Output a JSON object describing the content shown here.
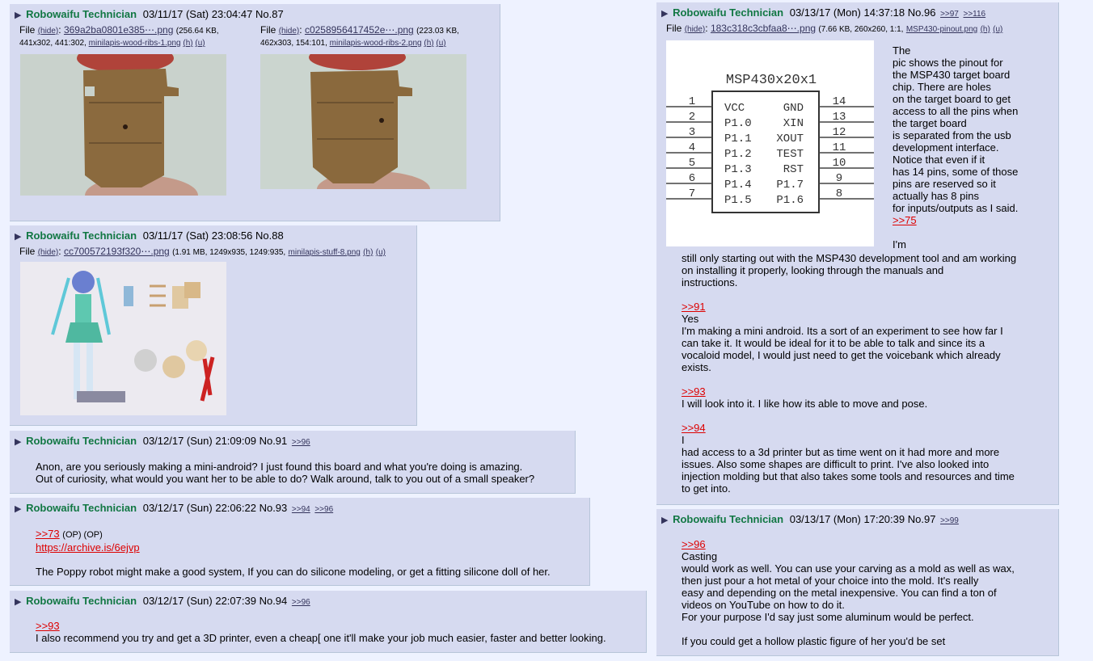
{
  "posts": {
    "p87": {
      "name": "Robowaifu Technician",
      "datetime": "03/11/17 (Sat) 23:04:47",
      "no": "No.87",
      "file1": {
        "label": "File",
        "hide": "(hide)",
        "fname": "369a2ba0801e385⋯.png",
        "meta1": "(256.64 KB,",
        "meta2": "441x302, 441:302,",
        "orig": "minilapis-wood-ribs-1.png",
        "h": "(h)",
        "u": "(u)"
      },
      "file2": {
        "label": "File",
        "hide": "(hide)",
        "fname": "c0258956417452e⋯.png",
        "meta1": "(223.03 KB,",
        "meta2": "462x303, 154:101,",
        "orig": "minilapis-wood-ribs-2.png",
        "h": "(h)",
        "u": "(u)"
      }
    },
    "p88": {
      "name": "Robowaifu Technician",
      "datetime": "03/11/17 (Sat) 23:08:56",
      "no": "No.88",
      "file": {
        "label": "File",
        "hide": "(hide)",
        "fname": "cc700572193f320⋯.png",
        "meta": "(1.91 MB, 1249x935, 1249:935,",
        "orig": "minilapis-stuff-8.png",
        "h": "(h)",
        "u": "(u)"
      }
    },
    "p91": {
      "name": "Robowaifu Technician",
      "datetime": "03/12/17 (Sun) 21:09:09",
      "no": "No.91",
      "backlinks": [
        ">>96"
      ],
      "text": "Anon, are you seriously making a mini-android? I just found this board and what you're doing is amazing.\nOut of curiosity, what would you want her to be able to do? Walk around, talk to you out of a small speaker?"
    },
    "p93": {
      "name": "Robowaifu Technician",
      "datetime": "03/12/17 (Sun) 22:06:22",
      "no": "No.93",
      "backlinks": [
        ">>94",
        ">>96"
      ],
      "quote": ">>73",
      "op": "(OP) (OP)",
      "link": "https://archive.is/6ejvp",
      "text": "The Poppy robot might make a good system, If you can do silicone modeling, or get a fitting silicone doll of her."
    },
    "p94": {
      "name": "Robowaifu Technician",
      "datetime": "03/12/17 (Sun) 22:07:39",
      "no": "No.94",
      "backlinks": [
        ">>96"
      ],
      "quote": ">>93",
      "text": "I also  recommend you try and get a 3D printer, even a cheap[ one it'll make your job much easier, faster and better looking."
    },
    "p96": {
      "name": "Robowaifu Technician",
      "datetime": "03/13/17 (Mon) 14:37:18",
      "no": "No.96",
      "backlinks": [
        ">>97",
        ">>116"
      ],
      "file": {
        "label": "File",
        "hide": "(hide)",
        "fname": "183c318c3cbfaa8⋯.png",
        "meta": "(7.66 KB, 260x260, 1:1,",
        "orig": "MSP430-pinout.png",
        "h": "(h)",
        "u": "(u)"
      },
      "side_text": "The\n pic shows the pinout for\nthe MSP430 target board\nchip. There are holes\non the target board to get\naccess to all the pins when\nthe target board\nis separated from the usb\ndevelopment interface.\nNotice that even if it\nhas 14 pins, some of those\npins are reserved so it\nactually has 8 pins\nfor inputs/outputs as I said.",
      "q75": ">>75",
      "im": "I'm",
      "text1": " still only starting out with the MSP430 development tool and am working\n on installing it properly, looking through the manuals and\ninstructions.",
      "q91": ">>91",
      "text2": "Yes\n I'm making a mini android. Its a sort of an experiment to see how far I\n can take it. It would be ideal for it to be able to talk and since its a\n vocaloid model, I would just need to get the voicebank which already\nexists.",
      "q93": ">>93",
      "text3": "I will look into it. I like how its able to move and pose.",
      "q94": ">>94",
      "text4": "I\n had access to a 3d printer but as time went on it had more and more\nissues. Also some shapes are difficult to print. I've also looked into\ninjection molding but that also takes some tools and resources and time\nto get into."
    },
    "p97": {
      "name": "Robowaifu Technician",
      "datetime": "03/13/17 (Mon) 17:20:39",
      "no": "No.97",
      "backlinks": [
        ">>99"
      ],
      "quote": ">>96",
      "text": "Casting\n would work as well. You can use your carving as a mold as well as wax,\nthen just pour a hot metal of your choice into the mold. It's really\neasy and depending on the metal inexpensive. You can find a ton of\nvideos on YouTube on how to do it.\nFor your purpose I'd say just some aluminum would be perfect.\n\nIf you could get a hollow plastic figure of her you'd be set"
    }
  },
  "pinout": {
    "title": "MSP430x20x1",
    "left": [
      {
        "num": "1",
        "sig": "VCC"
      },
      {
        "num": "2",
        "sig": "P1.0"
      },
      {
        "num": "3",
        "sig": "P1.1"
      },
      {
        "num": "4",
        "sig": "P1.2"
      },
      {
        "num": "5",
        "sig": "P1.3"
      },
      {
        "num": "6",
        "sig": "P1.4"
      },
      {
        "num": "7",
        "sig": "P1.5"
      }
    ],
    "right": [
      {
        "num": "14",
        "sig": "GND"
      },
      {
        "num": "13",
        "sig": "XIN"
      },
      {
        "num": "12",
        "sig": "XOUT"
      },
      {
        "num": "11",
        "sig": "TEST"
      },
      {
        "num": "10",
        "sig": "RST"
      },
      {
        "num": "9",
        "sig": "P1.7"
      },
      {
        "num": "8",
        "sig": "P1.6"
      }
    ]
  },
  "colors": {
    "bg": "#eef2ff",
    "post": "#d6daf0",
    "name": "#117743",
    "quote": "#dd0000",
    "link": "#34345c"
  }
}
